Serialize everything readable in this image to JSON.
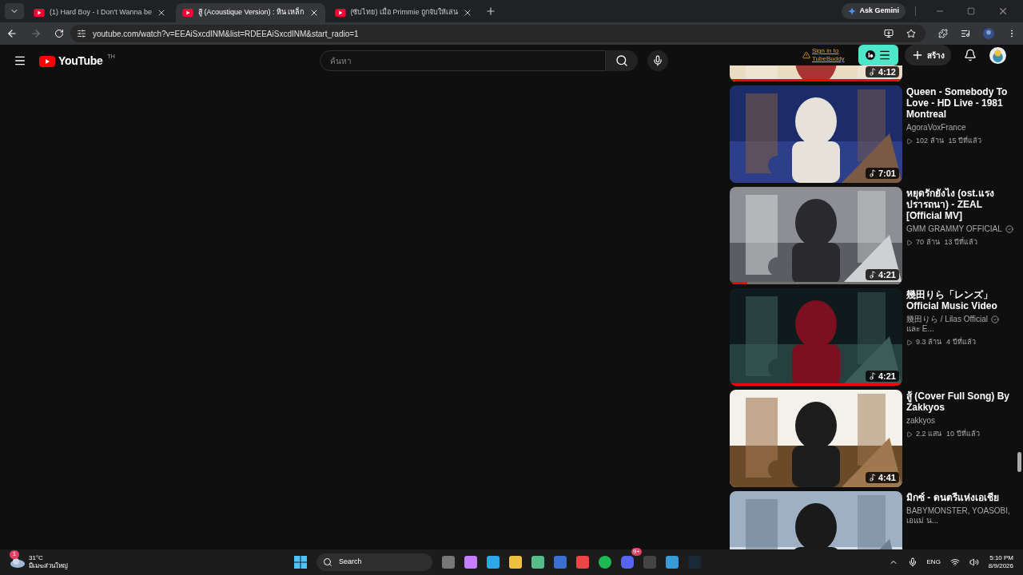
{
  "browser": {
    "tabs": [
      {
        "title": "(1) Hard Boy - I Don't Wanna be",
        "selected": false
      },
      {
        "title": "สู้ (Acoustique Version) : หิน เหล็ก",
        "selected": true
      },
      {
        "title": "(ซับไทย) เมื่อ Primmie ถูกจับให้เล่น",
        "selected": false
      }
    ],
    "ask_gemini": "Ask Gemini",
    "url": "youtube.com/watch?v=EEAiSxcdINM&list=RDEEAiSxcdINM&start_radio=1"
  },
  "youtube": {
    "logo_text": "YouTube",
    "region": "TH",
    "search": {
      "placeholder": "ค้นหา"
    },
    "tubebuddy": "Sign in to TubeBuddy",
    "create": "สร้าง"
  },
  "partial_video": {
    "duration": "4:12",
    "level": 1.0
  },
  "videos": [
    {
      "title": "Queen - Somebody To Love - HD Live - 1981 Montreal",
      "channel": "AgoraVoxFrance",
      "verified": false,
      "views": "102 ล้าน",
      "age": "15 ปีที่แล้ว",
      "duration": "7:01"
    },
    {
      "title": "หยุดรักยังไง (ost.แรงปรารถนา) - ZEAL [Official MV]",
      "channel": "GMM GRAMMY OFFICIAL",
      "verified": true,
      "views": "70 ล้าน",
      "age": "13 ปีที่แล้ว",
      "duration": "4:21",
      "level": 0.1
    },
    {
      "title": "幾田りら「レンズ」Official Music Video",
      "channel": "幾田りら / Lilas Official",
      "verified": true,
      "channel_suffix": "และ E...",
      "views": "9.3 ล้าน",
      "age": "4 ปีที่แล้ว",
      "duration": "4:21",
      "level": 1.0
    },
    {
      "title": "สู้ (Cover Full Song) By Zakkyos",
      "channel": "zakkyos",
      "verified": false,
      "views": "2.2 แสน",
      "age": "10 ปีที่แล้ว",
      "duration": "4:41"
    },
    {
      "title": "มิกซ์ - ดนตรีแห่งเอเชีย",
      "channel": "BABYMONSTER, YOASOBI, เอแม่ น...",
      "verified": false
    }
  ],
  "taskbar": {
    "weather": {
      "temp": "31°C",
      "desc": "มีเมฆส่วนใหญ่",
      "badge": "1"
    },
    "search": "Search",
    "discord_badge": "9+",
    "lang": "ENG",
    "time": "5:10 PM",
    "date": "8/9/2026"
  }
}
